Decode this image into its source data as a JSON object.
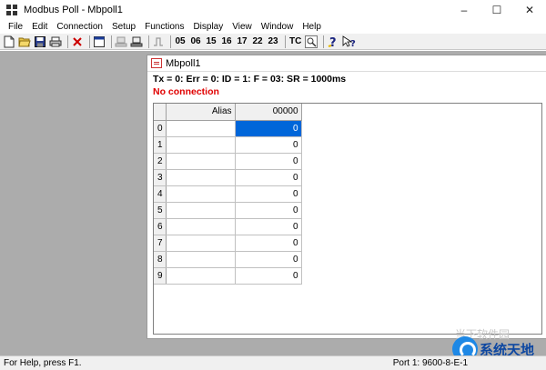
{
  "window": {
    "title": "Modbus Poll - Mbpoll1",
    "controls": {
      "minimize": "–",
      "maximize": "☐",
      "close": "✕"
    }
  },
  "menubar": {
    "items": [
      "File",
      "Edit",
      "Connection",
      "Setup",
      "Functions",
      "Display",
      "View",
      "Window",
      "Help"
    ]
  },
  "toolbar": {
    "icons": [
      "new-file-icon",
      "open-folder-icon",
      "save-icon",
      "print-icon",
      "delete-icon",
      "window-icon",
      "connect-icon",
      "disconnect-icon",
      "pulse-icon",
      "help-icon",
      "context-help-icon"
    ],
    "function_codes": [
      "05",
      "06",
      "15",
      "16",
      "17",
      "22",
      "23"
    ],
    "tc_label": "TC"
  },
  "child_window": {
    "title": "Mbpoll1",
    "info_line": "Tx = 0: Err = 0: ID = 1: F = 03: SR = 1000ms",
    "status_line": "No connection",
    "grid": {
      "headers": {
        "alias": "Alias",
        "value": "00000"
      },
      "rows": [
        {
          "index": "0",
          "alias": "",
          "value": "0"
        },
        {
          "index": "1",
          "alias": "",
          "value": "0"
        },
        {
          "index": "2",
          "alias": "",
          "value": "0"
        },
        {
          "index": "3",
          "alias": "",
          "value": "0"
        },
        {
          "index": "4",
          "alias": "",
          "value": "0"
        },
        {
          "index": "5",
          "alias": "",
          "value": "0"
        },
        {
          "index": "6",
          "alias": "",
          "value": "0"
        },
        {
          "index": "7",
          "alias": "",
          "value": "0"
        },
        {
          "index": "8",
          "alias": "",
          "value": "0"
        },
        {
          "index": "9",
          "alias": "",
          "value": "0"
        }
      ]
    }
  },
  "statusbar": {
    "help_text": "For Help, press F1.",
    "port_text": "Port 1: 9600-8-E-1"
  },
  "watermark": {
    "faint_text": "当下软件园",
    "logo_text": "系统天地"
  },
  "colors": {
    "selection": "#0066d9",
    "status_error": "#e00000",
    "mdi_background": "#acacac"
  }
}
